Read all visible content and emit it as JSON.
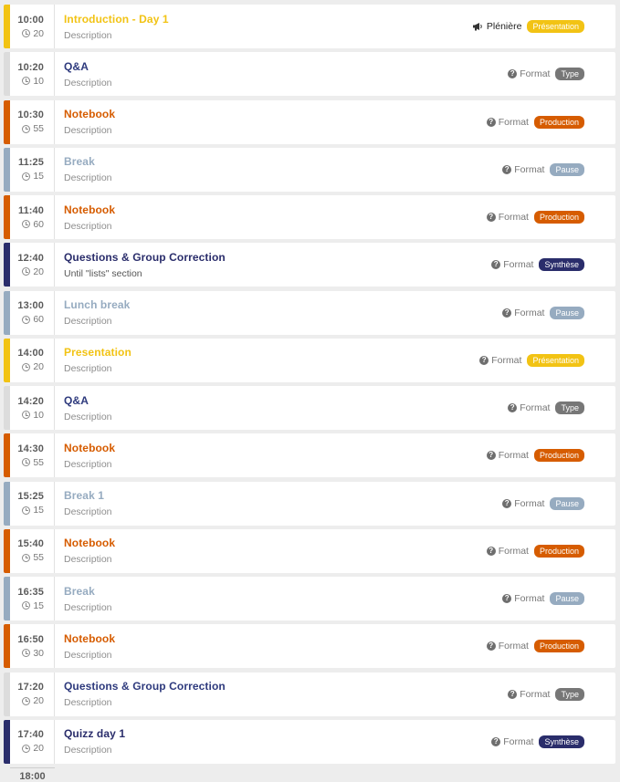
{
  "colors": {
    "presentation": "#f2c314",
    "type": "#dcdcdc",
    "type_badge": "#777777",
    "production": "#d65c00",
    "pause": "#96abc0",
    "synthese": "#2a2d6b",
    "qa_title": "#2e3a7d"
  },
  "schedule": [
    {
      "start": "10:00",
      "duration": "20",
      "title": "Introduction - Day 1",
      "description": "Description",
      "format": "Plénière",
      "format_icon": "megaphone-icon",
      "badge": "Présentation",
      "kind": "presentation"
    },
    {
      "start": "10:20",
      "duration": "10",
      "title": "Q&A",
      "description": "Description",
      "format": "Format",
      "format_icon": "question-icon",
      "badge": "Type",
      "kind": "type"
    },
    {
      "start": "10:30",
      "duration": "55",
      "title": "Notebook",
      "description": "Description",
      "format": "Format",
      "format_icon": "question-icon",
      "badge": "Production",
      "kind": "production"
    },
    {
      "start": "11:25",
      "duration": "15",
      "title": "Break",
      "description": "Description",
      "format": "Format",
      "format_icon": "question-icon",
      "badge": "Pause",
      "kind": "pause"
    },
    {
      "start": "11:40",
      "duration": "60",
      "title": "Notebook",
      "description": "Description",
      "format": "Format",
      "format_icon": "question-icon",
      "badge": "Production",
      "kind": "production"
    },
    {
      "start": "12:40",
      "duration": "20",
      "title": "Questions & Group Correction",
      "description": "Until \"lists\" section",
      "format": "Format",
      "format_icon": "question-icon",
      "badge": "Synthèse",
      "kind": "synthese"
    },
    {
      "start": "13:00",
      "duration": "60",
      "title": "Lunch break",
      "description": "Description",
      "format": "Format",
      "format_icon": "question-icon",
      "badge": "Pause",
      "kind": "pause"
    },
    {
      "start": "14:00",
      "duration": "20",
      "title": "Presentation",
      "description": "Description",
      "format": "Format",
      "format_icon": "question-icon",
      "badge": "Présentation",
      "kind": "presentation"
    },
    {
      "start": "14:20",
      "duration": "10",
      "title": "Q&A",
      "description": "Description",
      "format": "Format",
      "format_icon": "question-icon",
      "badge": "Type",
      "kind": "type"
    },
    {
      "start": "14:30",
      "duration": "55",
      "title": "Notebook",
      "description": "Description",
      "format": "Format",
      "format_icon": "question-icon",
      "badge": "Production",
      "kind": "production"
    },
    {
      "start": "15:25",
      "duration": "15",
      "title": "Break 1",
      "description": "Description",
      "format": "Format",
      "format_icon": "question-icon",
      "badge": "Pause",
      "kind": "pause"
    },
    {
      "start": "15:40",
      "duration": "55",
      "title": "Notebook",
      "description": "Description",
      "format": "Format",
      "format_icon": "question-icon",
      "badge": "Production",
      "kind": "production"
    },
    {
      "start": "16:35",
      "duration": "15",
      "title": "Break",
      "description": "Description",
      "format": "Format",
      "format_icon": "question-icon",
      "badge": "Pause",
      "kind": "pause"
    },
    {
      "start": "16:50",
      "duration": "30",
      "title": "Notebook",
      "description": "Description",
      "format": "Format",
      "format_icon": "question-icon",
      "badge": "Production",
      "kind": "production"
    },
    {
      "start": "17:20",
      "duration": "20",
      "title": "Questions & Group Correction",
      "description": "Description",
      "format": "Format",
      "format_icon": "question-icon",
      "badge": "Type",
      "kind": "type"
    },
    {
      "start": "17:40",
      "duration": "20",
      "title": "Quizz day 1",
      "description": "Description",
      "format": "Format",
      "format_icon": "question-icon",
      "badge": "Synthèse",
      "kind": "synthese"
    }
  ],
  "end_time": "18:00"
}
